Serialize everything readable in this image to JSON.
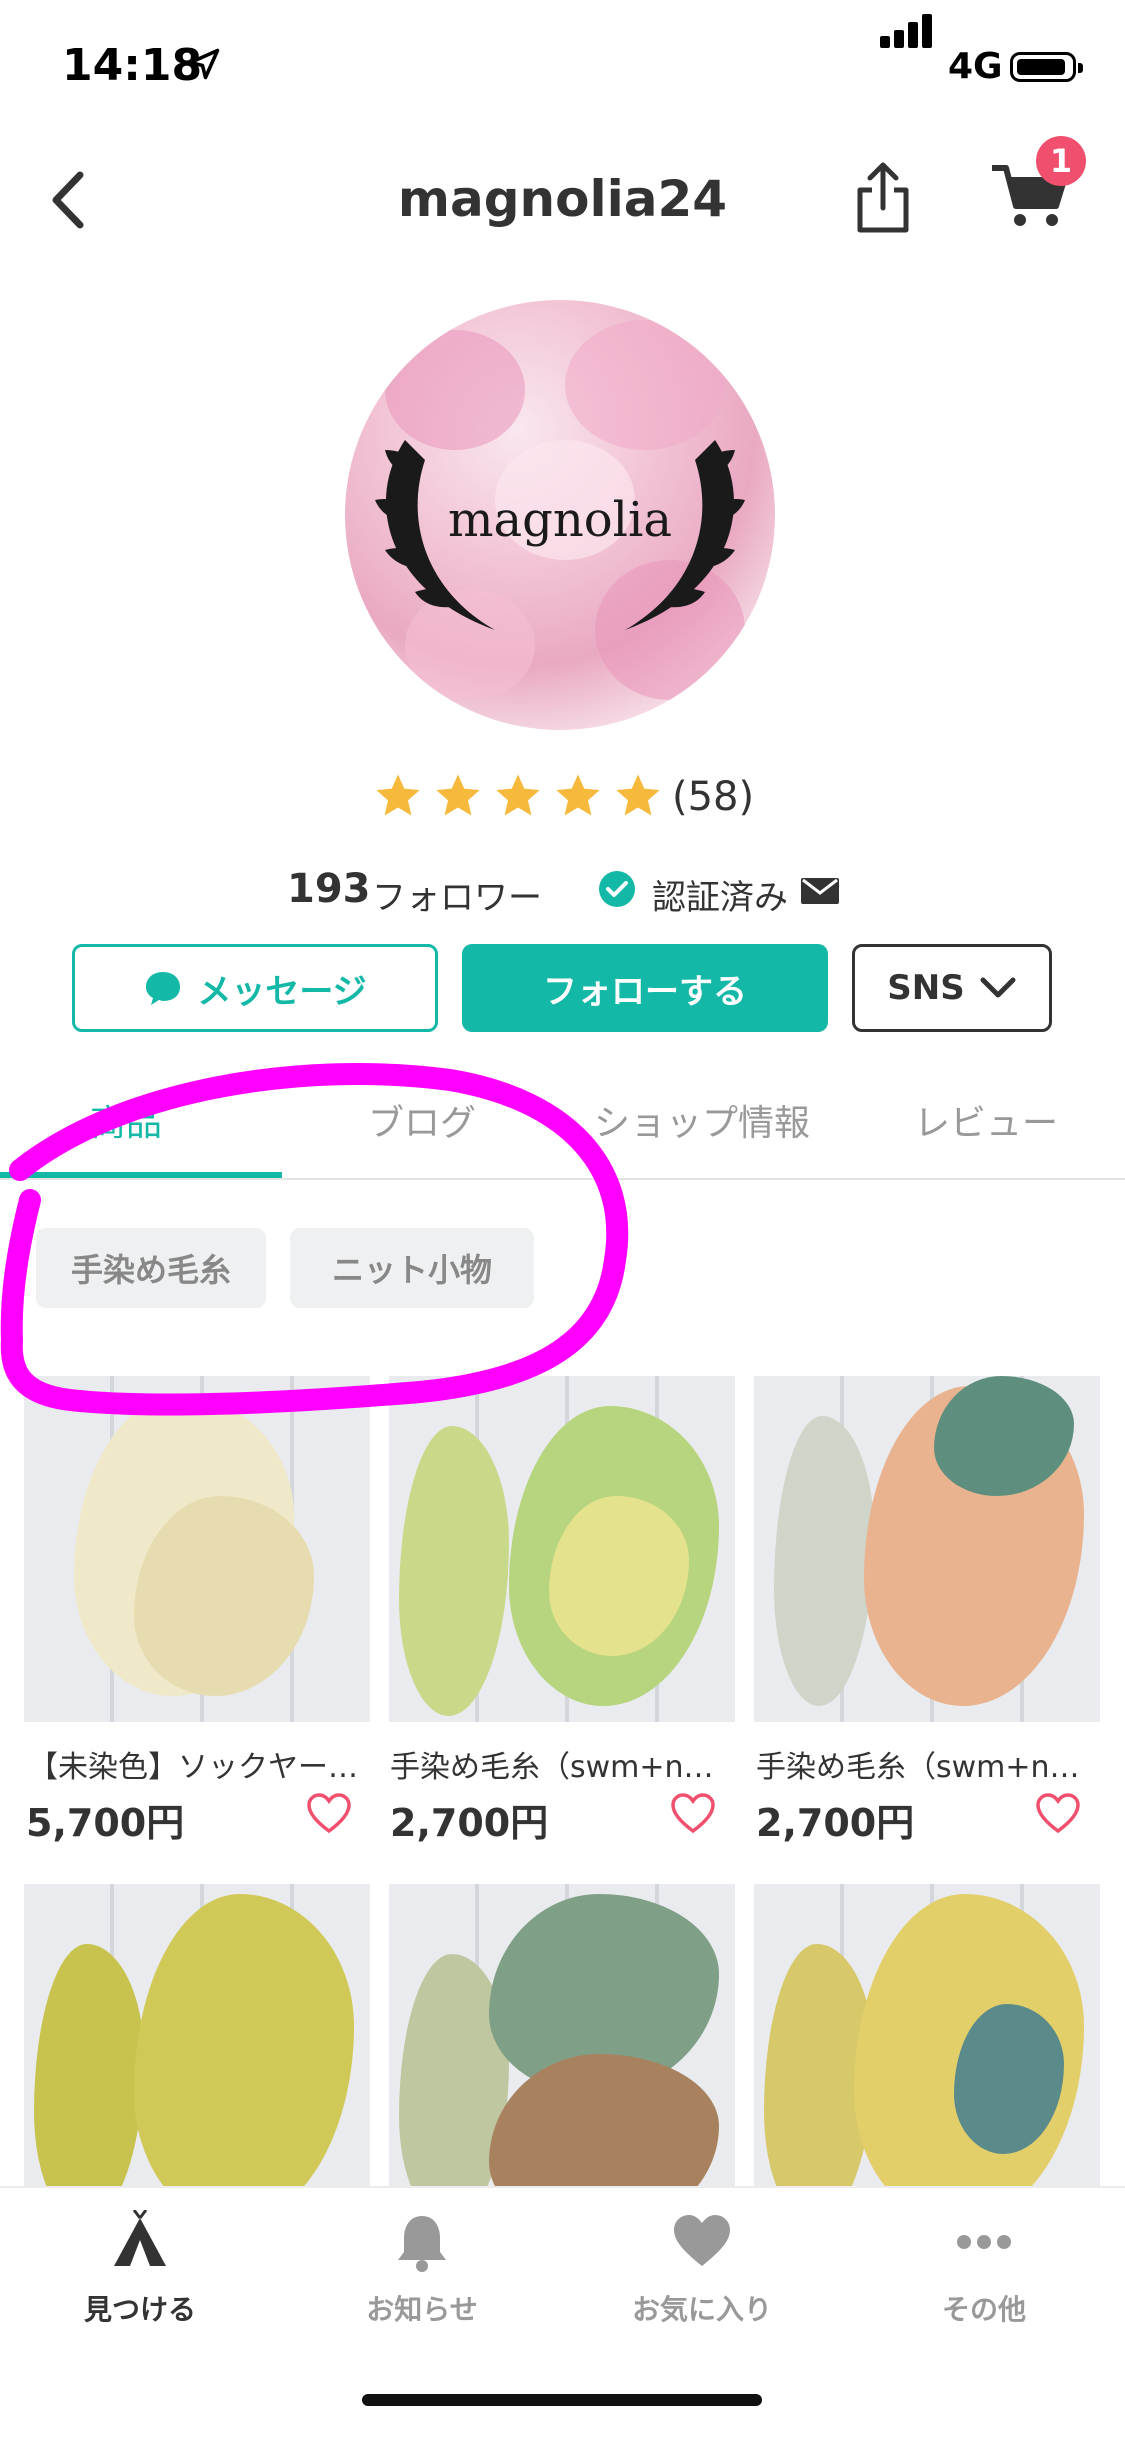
{
  "status_bar": {
    "time": "14:18",
    "network": "4G"
  },
  "header": {
    "title": "magnolia24",
    "cart_badge": "1"
  },
  "profile": {
    "logo_text": "magnolia",
    "rating": 5,
    "rating_count": "(58)",
    "followers_count": "193",
    "followers_label": "フォロワー",
    "verified_label": "認証済み"
  },
  "actions": {
    "message": "メッセージ",
    "follow": "フォローする",
    "sns": "SNS"
  },
  "tabs": [
    {
      "label": "商品",
      "active": true
    },
    {
      "label": "ブログ",
      "active": false
    },
    {
      "label": "ショップ情報",
      "active": false
    },
    {
      "label": "レビュー",
      "active": false
    }
  ],
  "chips": [
    {
      "label": "手染め毛糸"
    },
    {
      "label": "ニット小物"
    }
  ],
  "products": [
    {
      "name": "【未染色】ソックヤー…",
      "price": "5,700円"
    },
    {
      "name": "手染め毛糸（swm+n…",
      "price": "2,700円"
    },
    {
      "name": "手染め毛糸（swm+n…",
      "price": "2,700円"
    },
    {
      "name": "",
      "price": ""
    },
    {
      "name": "",
      "price": ""
    },
    {
      "name": "",
      "price": ""
    }
  ],
  "bottom_nav": [
    {
      "label": "見つける",
      "icon": "tent-icon",
      "active": true
    },
    {
      "label": "お知らせ",
      "icon": "bell-icon",
      "active": false
    },
    {
      "label": "お気に入り",
      "icon": "heart-icon",
      "active": false
    },
    {
      "label": "その他",
      "icon": "more-icon",
      "active": false
    }
  ],
  "colors": {
    "accent": "#14b8a6",
    "star": "#f6b93b",
    "badge": "#f0506e",
    "annotation": "#ff00ff",
    "heart": "#f0506e"
  }
}
